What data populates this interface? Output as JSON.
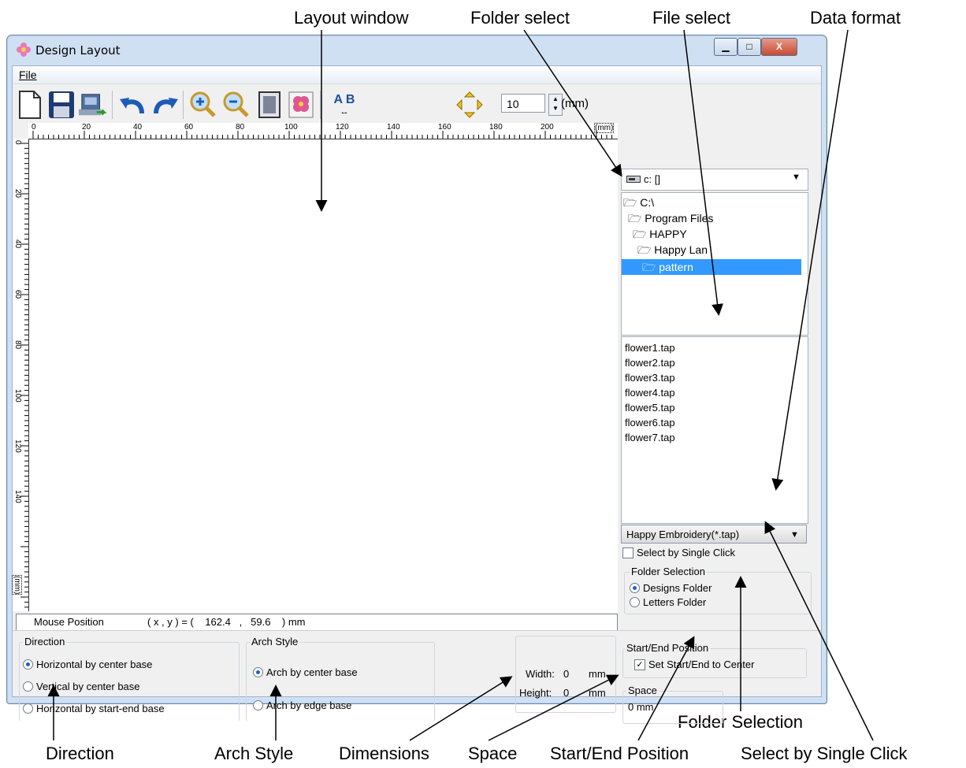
{
  "callouts": {
    "layout_window": "Layout window",
    "folder_select": "Folder select",
    "file_select": "File select",
    "data_format": "Data format",
    "folder_selection": "Folder Selection",
    "direction": "Direction",
    "arch_style": "Arch Style",
    "dimensions": "Dimensions",
    "space": "Space",
    "start_end_position": "Start/End Position",
    "select_by_single_click": "Select by Single Click"
  },
  "window": {
    "title": "Design Layout",
    "title_icon": "flower-icon",
    "controls": {
      "minimize": "▁",
      "maximize": "□",
      "close": "X"
    }
  },
  "menu": {
    "file": "File"
  },
  "toolbar": {
    "icons": [
      "new-document-icon",
      "save-icon",
      "send-to-machine-icon",
      "undo-icon",
      "redo-icon",
      "zoom-in-icon",
      "zoom-out-icon",
      "fit-page-icon",
      "design-view-icon",
      "letter-spacing-icon",
      "move-arrows-icon"
    ],
    "letters": "A B",
    "move_step": "10",
    "move_unit": "(mm)"
  },
  "rulers": {
    "h_ticks": [
      "0",
      "20",
      "40",
      "60",
      "80",
      "100",
      "120",
      "140",
      "160",
      "180",
      "200"
    ],
    "h_unit": "(mm)",
    "v_ticks": [
      "0",
      "20",
      "40",
      "60",
      "80",
      "100",
      "120",
      "140"
    ],
    "v_unit": "(mm)"
  },
  "status": {
    "label": "Mouse Position",
    "text": "( x , y ) = (    162.4   ,   59.6    ) mm",
    "x": 162.4,
    "y": 59.6
  },
  "drive": {
    "value": "c: []"
  },
  "folders": [
    {
      "label": "C:\\",
      "level": 0
    },
    {
      "label": "Program Files",
      "level": 1
    },
    {
      "label": "HAPPY",
      "level": 2
    },
    {
      "label": "Happy Lan",
      "level": 3
    },
    {
      "label": "pattern",
      "level": 4,
      "selected": true
    }
  ],
  "files": [
    "flower1.tap",
    "flower2.tap",
    "flower3.tap",
    "flower4.tap",
    "flower5.tap",
    "flower6.tap",
    "flower7.tap"
  ],
  "format": {
    "value": "Happy Embroidery(*.tap)"
  },
  "single_click": {
    "label": "Select by Single Click",
    "checked": false
  },
  "folder_selection": {
    "title": "Folder Selection",
    "options": [
      "Designs Folder",
      "Letters Folder"
    ],
    "selected": "Designs Folder"
  },
  "direction": {
    "title": "Direction",
    "options": [
      "Horizontal by center base",
      "Vertical by center base",
      "Horizontal by start-end base"
    ],
    "selected": "Horizontal by center base"
  },
  "arch_style": {
    "title": "Arch Style",
    "options": [
      "Arch by center base",
      "Arch by edge base"
    ],
    "selected": "Arch by center base"
  },
  "dimensions": {
    "width_label": "Width:",
    "width_value": "0",
    "height_label": "Height:",
    "height_value": "0",
    "unit": "mm"
  },
  "start_end": {
    "title": "Start/End Position",
    "checkbox": "Set Start/End to Center",
    "checked": true
  },
  "space": {
    "title": "Space",
    "value": "0 mm"
  }
}
